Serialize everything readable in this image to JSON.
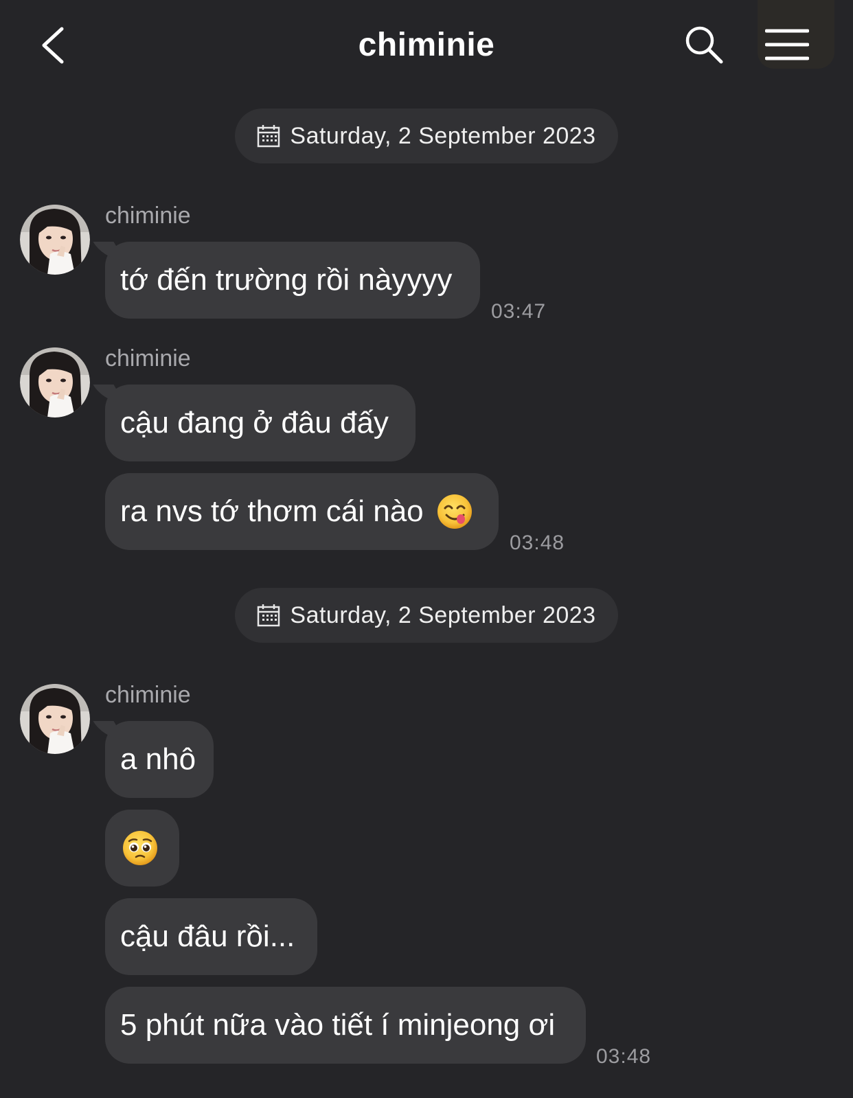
{
  "header": {
    "title": "chiminie",
    "back_icon": "chevron-left-icon",
    "search_icon": "search-icon",
    "menu_icon": "menu-icon"
  },
  "date_separators": [
    {
      "label": "Saturday, 2 September 2023",
      "icon": "calendar-icon"
    },
    {
      "label": "Saturday, 2 September 2023",
      "icon": "calendar-icon"
    }
  ],
  "groups": [
    {
      "sender": "chiminie",
      "messages": [
        {
          "text": "tớ đến trường rồi nàyyyy"
        }
      ],
      "time": "03:47"
    },
    {
      "sender": "chiminie",
      "messages": [
        {
          "text": "cậu đang ở đâu đấy"
        },
        {
          "text": "ra nvs tớ thơm cái nào",
          "emoji": "yum-face-emoji"
        }
      ],
      "time": "03:48"
    },
    {
      "sender": "chiminie",
      "messages": [
        {
          "text": "a nhô"
        },
        {
          "emoji": "pleading-face-emoji"
        },
        {
          "text": "cậu đâu rồi..."
        },
        {
          "text": "5 phút nữa vào tiết í minjeong ơi"
        }
      ],
      "time": "03:48"
    }
  ],
  "colors": {
    "background": "#252528",
    "bubble": "#3a3a3d",
    "date_pill": "#313134",
    "sender_text": "#a9a9ad",
    "time_text": "#9c9ca0"
  }
}
